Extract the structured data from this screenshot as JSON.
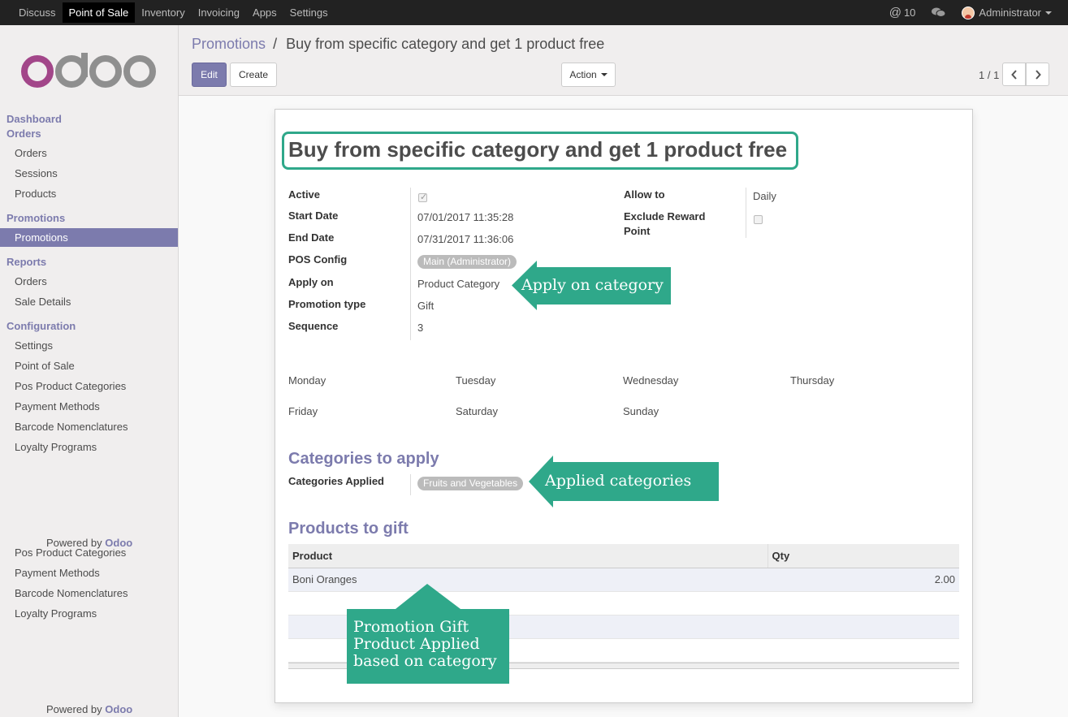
{
  "topbar": {
    "menu": [
      "Discuss",
      "Point of Sale",
      "Inventory",
      "Invoicing",
      "Apps",
      "Settings"
    ],
    "active": "Point of Sale",
    "notifications": "10",
    "user": "Administrator",
    "at_icon": "@"
  },
  "sidebar": {
    "logo": "odoo",
    "dashboard": "Dashboard",
    "orders_head": "Orders",
    "orders_items": [
      "Orders",
      "Sessions",
      "Products"
    ],
    "promotions_head": "Promotions",
    "promotions_item": "Promotions",
    "reports_head": "Reports",
    "reports_items": [
      "Orders",
      "Sale Details"
    ],
    "config_head": "Configuration",
    "config_items": [
      "Settings",
      "Point of Sale",
      "Pos Product Categories",
      "Payment Methods",
      "Barcode Nomenclatures",
      "Loyalty Programs"
    ],
    "repeat_items": [
      "Pos Product Categories",
      "Payment Methods",
      "Barcode Nomenclatures",
      "Loyalty Programs"
    ],
    "powered_prefix": "Powered by",
    "powered_brand": "Odoo"
  },
  "control": {
    "breadcrumb_parent": "Promotions",
    "breadcrumb_sep": "/",
    "breadcrumb_current": "Buy from specific category and get 1 product free",
    "edit": "Edit",
    "create": "Create",
    "action": "Action",
    "pager": "1 / 1"
  },
  "form": {
    "title": "Buy from specific category and get 1 product free",
    "labels": {
      "active": "Active",
      "start_date": "Start Date",
      "end_date": "End Date",
      "pos_config": "POS Config",
      "apply_on": "Apply on",
      "promotion_type": "Promotion type",
      "sequence": "Sequence",
      "allow_to": "Allow to",
      "exclude_reward_1": "Exclude Reward",
      "exclude_reward_2": "Point"
    },
    "values": {
      "active": true,
      "start_date": "07/01/2017 11:35:28",
      "end_date": "07/31/2017 11:36:06",
      "pos_config": "Main (Administrator)",
      "apply_on": "Product Category",
      "promotion_type": "Gift",
      "sequence": "3",
      "allow_to": "Daily",
      "exclude_reward": false
    },
    "days": [
      "Monday",
      "Tuesday",
      "Wednesday",
      "Thursday",
      "Friday",
      "Saturday",
      "Sunday"
    ],
    "categories_section": "Categories to apply",
    "categories_label": "Categories Applied",
    "categories_tag": "Fruits and Vegetables",
    "gift_section": "Products to gift",
    "gift_columns": [
      "Product",
      "Qty"
    ],
    "gift_rows": [
      {
        "product": "Boni Oranges",
        "qty": "2.00"
      }
    ]
  },
  "callouts": {
    "apply_on": "Apply on category",
    "applied": "Applied categories",
    "gift_1": "Promotion Gift",
    "gift_2": "Product Applied",
    "gift_3": "based on category"
  },
  "colors": {
    "brand": "#7c7bad",
    "callout": "#2fa88a",
    "topbar": "#222222"
  }
}
